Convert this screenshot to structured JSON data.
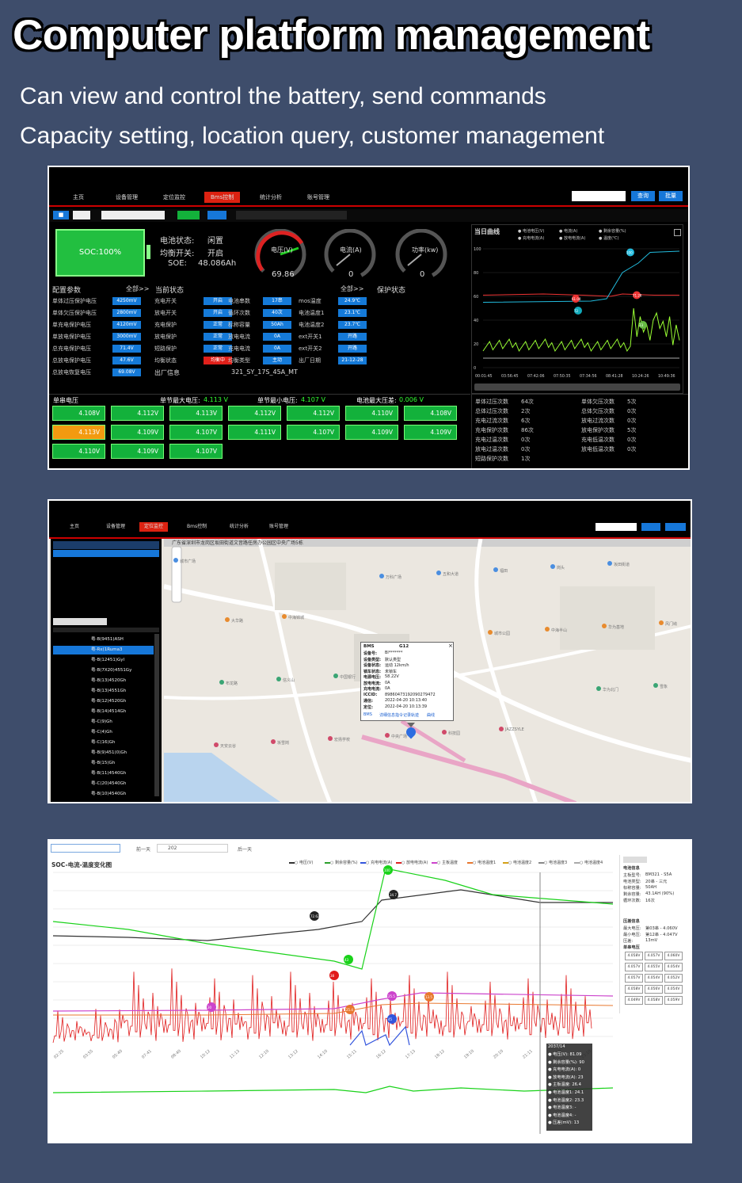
{
  "header": {
    "title": "Computer platform management",
    "line1": "Can view and control the battery, send commands",
    "line2": "Capacity setting, location query, customer management"
  },
  "dash": {
    "nav": [
      "主页",
      "设备管理",
      "定位监控",
      "Bms控制",
      "统计分析",
      "账号管理"
    ],
    "nav_active_index": 3,
    "query_btn": "查询",
    "export_btn": "批量",
    "status": {
      "label1": "电池状态:",
      "val1": "闲置",
      "label2": "均衡开关:",
      "val2": "开启",
      "label3": "SOE:",
      "val3": "48.086Ah",
      "soc": "SOC:100%"
    },
    "gauges": [
      {
        "label": "电压(V)",
        "value": "69.86"
      },
      {
        "label": "电流(A)",
        "value": "0"
      },
      {
        "label": "功率(kw)",
        "value": "0"
      }
    ],
    "curve_title": "当日曲线",
    "curve_legend": [
      "电池电压(V)",
      "电流(A)",
      "剩余容量(%)",
      "充电电流(A)",
      "放电电流(A)",
      "温度(℃)"
    ],
    "curve_ylabels": [
      "100",
      "80",
      "60",
      "40",
      "20",
      "0"
    ],
    "curve_xlabels": [
      "00:01:45",
      "03:56:45",
      "07:42:06",
      "07:50:35",
      "07:34:56",
      "08:41:28",
      "10:24:26",
      "10:49:36"
    ],
    "curve_markers": [
      "61.04",
      "72",
      "71.26",
      "23",
      "100"
    ],
    "config_title": "配置参数",
    "config_all": "全部>>",
    "config": [
      {
        "k": "单体过压保护电压",
        "v": "4250mV"
      },
      {
        "k": "单体欠压保护电压",
        "v": "2800mV"
      },
      {
        "k": "单充电保护电压",
        "v": "4120mV"
      },
      {
        "k": "单放电保护电压",
        "v": "3000mV"
      },
      {
        "k": "总充电保护电压",
        "v": "71.4V"
      },
      {
        "k": "总放电保护电压",
        "v": "47.6V"
      },
      {
        "k": "总放电恢复电压",
        "v": "69.08V"
      }
    ],
    "state_title": "当前状态",
    "state_all": "全部>>",
    "protect_title": "保护状态",
    "state_rows": [
      [
        "充电开关",
        "开启",
        "电池串数",
        "17串",
        "mos温度",
        "24.9℃"
      ],
      [
        "放电开关",
        "开启",
        "循环次数",
        "40次",
        "电池温度1",
        "23.1℃"
      ],
      [
        "充电保护",
        "正常",
        "标称容量",
        "50Ah",
        "电池温度2",
        "23.7℃"
      ],
      [
        "放电保护",
        "正常",
        "放电电流",
        "0A",
        "ext开关1",
        "开路"
      ],
      [
        "短路保护",
        "正常",
        "充电电流",
        "0A",
        "ext开关2",
        "开路"
      ],
      [
        "均衡状态",
        "均衡中",
        "均衡类型",
        "主动",
        "出厂日期",
        "21-12-28"
      ]
    ],
    "factory_label": "出厂信息",
    "factory_val": "321_SY_17S_45A_MT",
    "cell_header": {
      "h1": "单串电压",
      "h2": "单节最大电压:",
      "h2v": "4.113 V",
      "h3": "单节最小电压:",
      "h3v": "4.107 V",
      "h4": "电池最大压差:",
      "h4v": "0.006 V"
    },
    "cells": [
      "4.108V",
      "4.112V",
      "4.113V",
      "4.112V",
      "4.112V",
      "4.110V",
      "4.108V",
      "4.113V",
      "4.109V",
      "4.107V",
      "4.111V",
      "4.107V",
      "4.109V",
      "4.109V",
      "4.110V",
      "4.109V",
      "4.107V"
    ],
    "prot_left": [
      [
        "单体过压次数",
        "64次"
      ],
      [
        "总体过压次数",
        "2次"
      ],
      [
        "充电过流次数",
        "6次"
      ],
      [
        "充电保护次数",
        "86次"
      ],
      [
        "充电过温次数",
        "0次"
      ],
      [
        "放电过温次数",
        "0次"
      ],
      [
        "短路保护次数",
        "1次"
      ]
    ],
    "prot_right": [
      [
        "单体欠压次数",
        "5次"
      ],
      [
        "总体欠压次数",
        "0次"
      ],
      [
        "放电过流次数",
        "0次"
      ],
      [
        "放电保护次数",
        "5次"
      ],
      [
        "充电低温次数",
        "0次"
      ],
      [
        "放电低温次数",
        "0次"
      ]
    ]
  },
  "map": {
    "nav": [
      "主页",
      "设备管理",
      "定位监控",
      "Bms控制",
      "统计分析",
      "账号管理"
    ],
    "nav_active_index": 2,
    "address": "广东省深圳市龙岗区坂田街道文音路任房办公园区中央广场5栋",
    "popup": {
      "title": "BMS",
      "gsm": "G12",
      "rows": [
        [
          "设备号:",
          "Bl*******"
        ],
        [
          "设备类型:",
          "默认类型"
        ],
        [
          "设备状态:",
          "运动 12km/h"
        ],
        [
          "锁车状态:",
          "未锁车"
        ],
        [
          "电源电压:",
          "58.22V"
        ],
        [
          "放电电流:",
          "0A"
        ],
        [
          "充电电流:",
          "0A"
        ],
        [
          "ICCID:",
          "89860473192090279472"
        ],
        [
          "通信:",
          "2022-04-20 10:13:40"
        ],
        [
          "定位:",
          "2022-04-20 10:13:39"
        ]
      ],
      "links": [
        "BMS",
        "详细信息",
        "指令记录",
        "轨迹",
        "曲线"
      ]
    },
    "places": [
      "城市广场",
      "中海锦城",
      "万科城",
      "JAZZSYLE",
      "坂田街道",
      "大华路",
      "中国银行",
      "科技园",
      "岗头",
      "风门坳",
      "信义山",
      "中央广场",
      "福田",
      "华为基地",
      "布龙路",
      "宏扬学校",
      "五和大道",
      "中海半山",
      "雪象",
      "坂雪岗",
      "万科广场",
      "城市公园",
      "华为北门",
      "天安云谷"
    ],
    "list": [
      "粤-B(9451)ASH",
      "粤-Rx(1Ruma3",
      "粤-B(12451)Gyl",
      "粤-B(7X20)4551Gy",
      "粤-B(13)4520Gh",
      "粤-B(13)4551Gh",
      "粤-B(12)4520Gh",
      "粤-B(14)4514Gh",
      "粤-C(9)Gh",
      "粤-C(4)Gh",
      "粤-C(16)Gh",
      "粤-B(9)451(0)Gh",
      "粤-B(15)Gh",
      "粤-B(11)4540Gh",
      "粤-C(20)4540Gh",
      "粤-B(10)4540Gh"
    ]
  },
  "trend": {
    "title": "SOC-电流-温度变化图",
    "prev_btn": "前一天",
    "next_btn": "后一天",
    "date": "202",
    "legend": [
      "电压(V)",
      "剩余容量(%)",
      "充电电流(A)",
      "放电电流(A)",
      "主板温度",
      "电池温度1",
      "电池温度2",
      "电池温度3",
      "电池温度4"
    ],
    "markers": [
      "72.62",
      "34.7",
      "100",
      "43",
      "38",
      "30",
      "25.5",
      "25.4",
      "13.5",
      "45"
    ],
    "side": {
      "t1": "电池信息",
      "rows": [
        [
          "主板型号:",
          "BM321 - S5A"
        ],
        [
          "电池类型:",
          "20串 - 三元"
        ],
        [
          "标称容量:",
          "50AH"
        ],
        [
          "剩余容量:",
          "43.1AH (90%)"
        ],
        [
          "循环次数:",
          "16次"
        ]
      ],
      "t2": "压差信息",
      "rows2": [
        [
          "最大电压:",
          "第03串 - 4.060V"
        ],
        [
          "最小电压:",
          "第12串 - 4.047V"
        ],
        [
          "压差:",
          "13mV"
        ]
      ],
      "t3": "单串电压"
    },
    "cells": [
      "4.058V",
      "4.057V",
      "4.060V",
      "4.057V",
      "4.055V",
      "4.054V",
      "4.057V",
      "4.054V",
      "4.052V",
      "4.058V",
      "4.056V",
      "4.054V",
      "4.049V",
      "4.058V",
      "4.059V"
    ],
    "tooltip": {
      "date": "2037/14",
      "rows": [
        "电压(V): 81.09",
        "剩余容量(%): 90",
        "充电电流(A): 0",
        "放电电流(A): 23",
        "主板温度: 26.4",
        "电池温度1: 24.1",
        "电池温度2: 23.3",
        "电池温度3: -",
        "电池温度4: -",
        "压差(mV): 13"
      ]
    },
    "xlabels": [
      "02:25",
      "03:55",
      "05:40",
      "07:41",
      "08:40",
      "10:12",
      "11:13",
      "12:10",
      "13:12",
      "14:10",
      "15:11",
      "16:12",
      "17:13",
      "18:12",
      "19:10",
      "20:10",
      "21:11",
      "22:12",
      "23:10"
    ]
  }
}
